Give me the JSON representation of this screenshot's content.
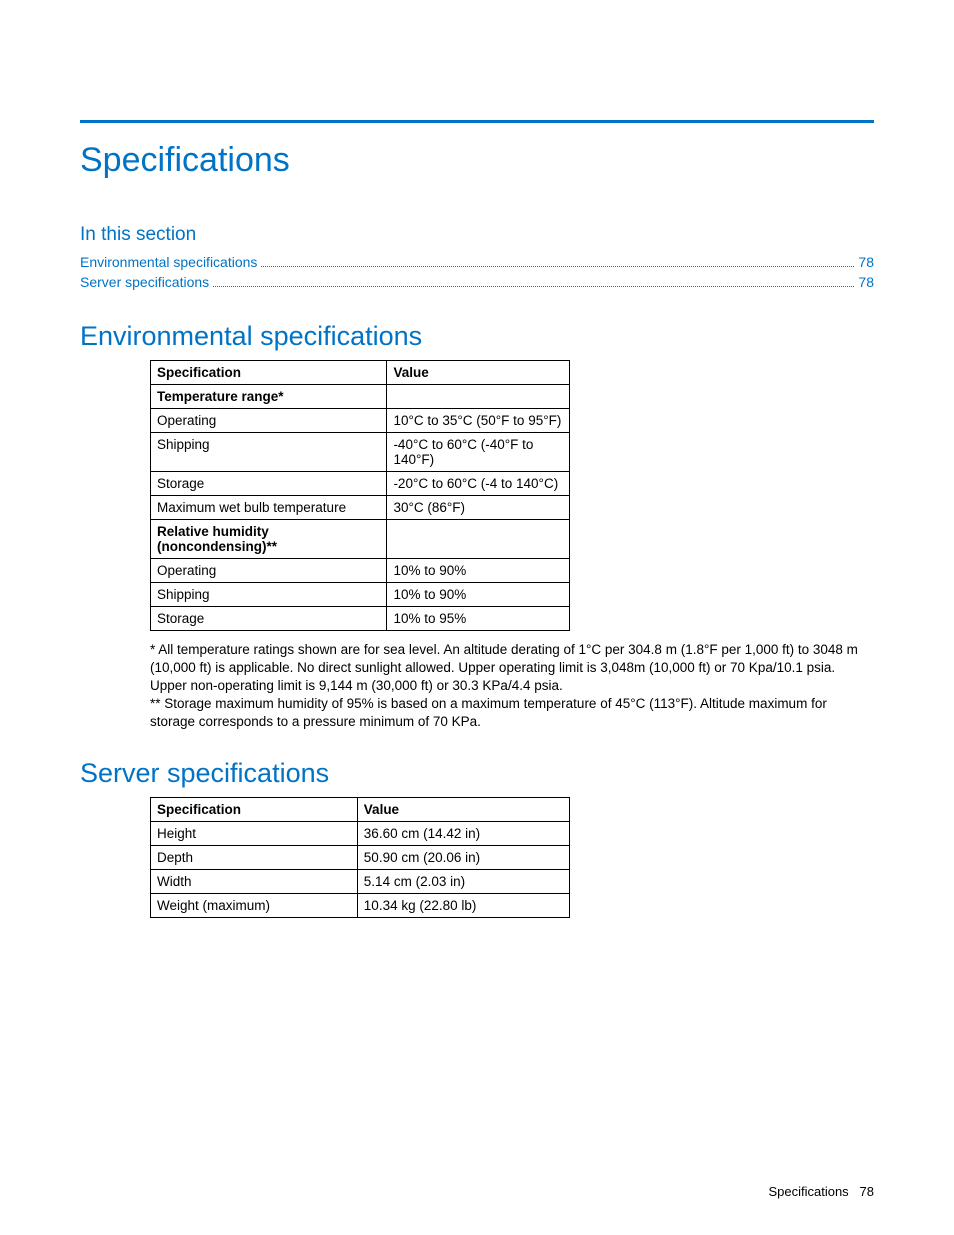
{
  "title": "Specifications",
  "sectionLabel": "In this section",
  "toc": [
    {
      "label": "Environmental specifications",
      "page": "78"
    },
    {
      "label": "Server specifications",
      "page": "78"
    }
  ],
  "env": {
    "heading": "Environmental specifications",
    "headers": {
      "col1": "Specification",
      "col2": "Value"
    },
    "rows": [
      {
        "spec": "Temperature range*",
        "value": "",
        "bold": true
      },
      {
        "spec": "Operating",
        "value": "10°C  to 35°C (50°F to 95°F)"
      },
      {
        "spec": "Shipping",
        "value": "-40°C  to 60°C (-40°F to 140°F)"
      },
      {
        "spec": "Storage",
        "value": "-20°C to 60°C (-4 to 140°C)"
      },
      {
        "spec": "Maximum wet bulb temperature",
        "value": "30°C (86°F)"
      },
      {
        "spec": "Relative humidity (noncondensing)**",
        "value": "",
        "bold": true
      },
      {
        "spec": "Operating",
        "value": "10% to 90%"
      },
      {
        "spec": "Shipping",
        "value": "10% to 90%"
      },
      {
        "spec": "Storage",
        "value": "10% to 95%"
      }
    ],
    "note1": "* All temperature ratings shown are for sea level. An altitude derating of 1°C per 304.8 m (1.8°F per 1,000 ft) to 3048 m (10,000 ft) is applicable. No direct sunlight allowed. Upper operating limit is 3,048m (10,000 ft) or 70 Kpa/10.1 psia. Upper non-operating limit is 9,144 m (30,000 ft) or 30.3 KPa/4.4 psia.",
    "note2": "** Storage maximum humidity of 95% is based on a maximum temperature of 45°C (113°F). Altitude maximum for storage corresponds to a pressure minimum of 70 KPa."
  },
  "server": {
    "heading": "Server specifications",
    "headers": {
      "col1": "Specification",
      "col2": "Value"
    },
    "rows": [
      {
        "spec": "Height",
        "value": "36.60 cm (14.42 in)"
      },
      {
        "spec": "Depth",
        "value": "50.90 cm (20.06 in)"
      },
      {
        "spec": "Width",
        "value": "5.14 cm (2.03 in)"
      },
      {
        "spec": "Weight (maximum)",
        "value": "10.34 kg (22.80 lb)"
      }
    ]
  },
  "footer": {
    "label": "Specifications",
    "page": "78"
  }
}
